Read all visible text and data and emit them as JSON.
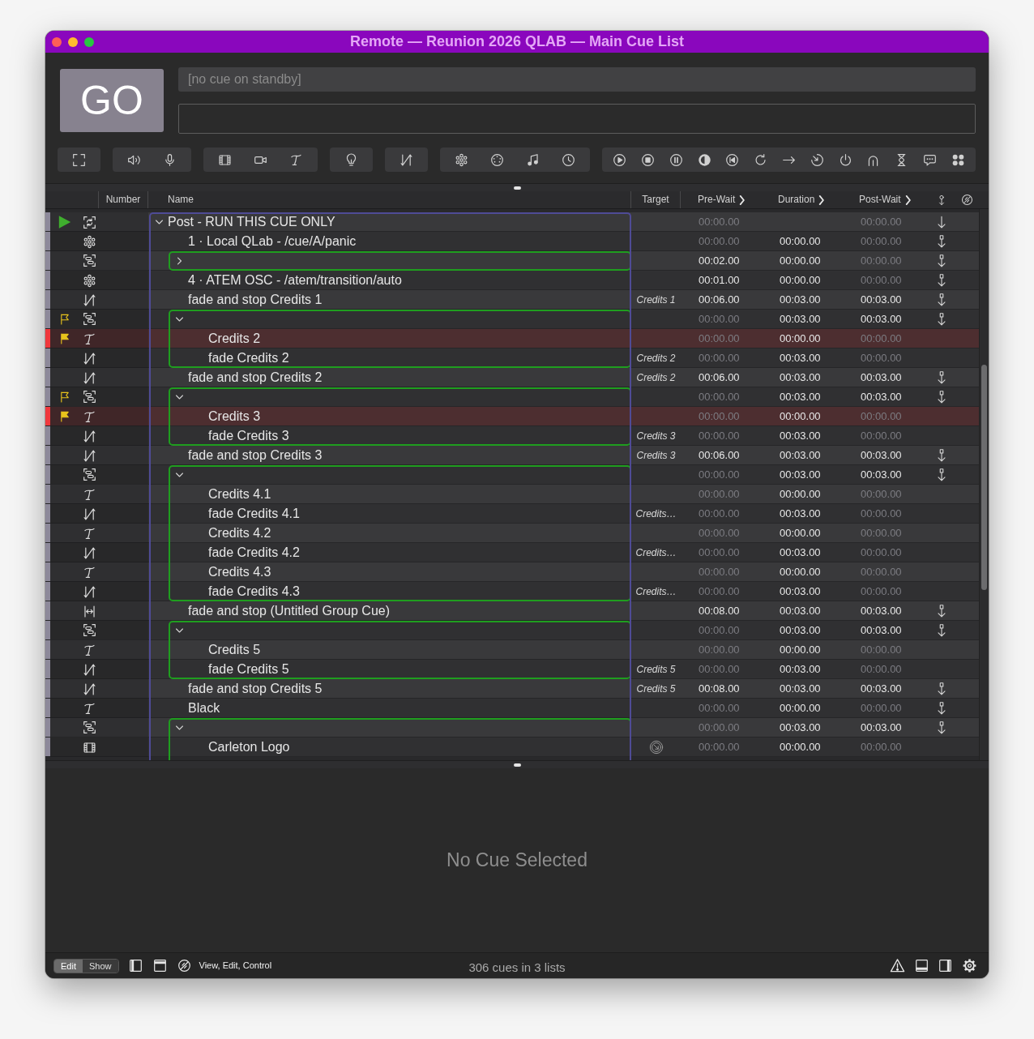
{
  "window": {
    "title": "Remote — Reunion 2026 QLAB — Main Cue List"
  },
  "go_button": {
    "label": "GO"
  },
  "standby": {
    "placeholder": "[no cue on standby]"
  },
  "toolbar": [
    {
      "buttons": [
        {
          "kind": "fullscreen"
        }
      ]
    },
    {
      "buttons": [
        {
          "kind": "audio"
        },
        {
          "kind": "mic"
        }
      ]
    },
    {
      "buttons": [
        {
          "kind": "video"
        },
        {
          "kind": "camera"
        },
        {
          "kind": "text"
        }
      ]
    },
    {
      "buttons": [
        {
          "kind": "light"
        }
      ]
    },
    {
      "buttons": [
        {
          "kind": "fade"
        }
      ]
    },
    {
      "buttons": [
        {
          "kind": "network"
        },
        {
          "kind": "midi"
        },
        {
          "kind": "music"
        },
        {
          "kind": "timecode"
        }
      ]
    },
    {
      "buttons": [
        {
          "kind": "start"
        },
        {
          "kind": "stop"
        },
        {
          "kind": "pause"
        },
        {
          "kind": "load"
        },
        {
          "kind": "goto"
        },
        {
          "kind": "reset"
        },
        {
          "kind": "target"
        },
        {
          "kind": "arm"
        },
        {
          "kind": "disarm"
        },
        {
          "kind": "devamp"
        },
        {
          "kind": "wait"
        },
        {
          "kind": "memo"
        },
        {
          "kind": "script"
        }
      ]
    }
  ],
  "cue_list": {
    "columns": [
      {
        "label": "Number",
        "chevron": false
      },
      {
        "label": "Name",
        "chevron": false
      },
      {
        "label": "Target",
        "chevron": false
      },
      {
        "label": "Pre-Wait",
        "chevron": true
      },
      {
        "label": "Duration",
        "chevron": true
      },
      {
        "label": "Post-Wait",
        "chevron": true
      }
    ],
    "cues": [
      {
        "kind": "random_group",
        "name": "Post - RUN THIS CUE ONLY",
        "expanded": true,
        "running": true,
        "flagged": false,
        "child_flagged": false,
        "pre_wait": {
          "text": "00:00.00",
          "dimmed": true
        },
        "post_wait": {
          "text": "00:00.00",
          "dimmed": true
        },
        "auto_continue": true,
        "auto_follow": false,
        "children": [
          {
            "kind": "network",
            "name": "1 · Local QLab - /cue/A/panic",
            "running": false,
            "flagged": false,
            "child_flagged": false,
            "pre_wait": {
              "text": "00:00.00",
              "dimmed": true
            },
            "duration": "00:00.00",
            "post_wait": {
              "text": "00:00.00",
              "dimmed": true
            },
            "auto_continue": false,
            "auto_follow": true
          },
          {
            "kind": "timeline_group",
            "expanded": false,
            "running": false,
            "flagged": false,
            "child_flagged": false,
            "pre_wait": {
              "text": "00:02.00",
              "dimmed": false
            },
            "duration": "00:00.00",
            "post_wait": {
              "text": "00:00.00",
              "dimmed": true
            },
            "auto_continue": false,
            "auto_follow": true
          },
          {
            "kind": "network",
            "name": "4 · ATEM OSC - /atem/transition/auto",
            "running": false,
            "flagged": false,
            "child_flagged": false,
            "pre_wait": {
              "text": "00:01.00",
              "dimmed": false
            },
            "duration": "00:00.00",
            "post_wait": {
              "text": "00:00.00",
              "dimmed": true
            },
            "auto_continue": false,
            "auto_follow": true
          },
          {
            "kind": "fade",
            "name": "fade and stop Credits 1",
            "target": "Credits 1",
            "running": false,
            "flagged": false,
            "child_flagged": false,
            "pre_wait": {
              "text": "00:06.00",
              "dimmed": false
            },
            "duration": "00:03.00",
            "post_wait": {
              "text": "00:03.00",
              "dimmed": false
            },
            "auto_continue": false,
            "auto_follow": true
          },
          {
            "kind": "timeline_group",
            "expanded": true,
            "running": false,
            "flagged": false,
            "child_flagged": true,
            "pre_wait": {
              "text": "00:00.00",
              "dimmed": true
            },
            "duration": "00:03.00",
            "post_wait": {
              "text": "00:03.00",
              "dimmed": false
            },
            "auto_continue": false,
            "auto_follow": true,
            "children": [
              {
                "kind": "text",
                "name": "Credits 2",
                "color": "#f0383d",
                "running": false,
                "flagged": true,
                "child_flagged": false,
                "pre_wait": {
                  "text": "00:00.00",
                  "dimmed": true
                },
                "duration": "00:00.00",
                "post_wait": {
                  "text": "00:00.00",
                  "dimmed": true
                },
                "auto_continue": false,
                "auto_follow": false
              },
              {
                "kind": "fade",
                "name": "fade Credits 2",
                "target": "Credits 2",
                "running": false,
                "flagged": false,
                "child_flagged": false,
                "pre_wait": {
                  "text": "00:00.00",
                  "dimmed": true
                },
                "duration": "00:03.00",
                "post_wait": {
                  "text": "00:00.00",
                  "dimmed": true
                },
                "auto_continue": false,
                "auto_follow": false
              }
            ]
          },
          {
            "kind": "fade",
            "name": "fade and stop Credits 2",
            "target": "Credits 2",
            "running": false,
            "flagged": false,
            "child_flagged": false,
            "pre_wait": {
              "text": "00:06.00",
              "dimmed": false
            },
            "duration": "00:03.00",
            "post_wait": {
              "text": "00:03.00",
              "dimmed": false
            },
            "auto_continue": false,
            "auto_follow": true
          },
          {
            "kind": "timeline_group",
            "expanded": true,
            "running": false,
            "flagged": false,
            "child_flagged": true,
            "pre_wait": {
              "text": "00:00.00",
              "dimmed": true
            },
            "duration": "00:03.00",
            "post_wait": {
              "text": "00:03.00",
              "dimmed": false
            },
            "auto_continue": false,
            "auto_follow": true,
            "children": [
              {
                "kind": "text",
                "name": "Credits 3",
                "color": "#f0383d",
                "running": false,
                "flagged": true,
                "child_flagged": false,
                "pre_wait": {
                  "text": "00:00.00",
                  "dimmed": true
                },
                "duration": "00:00.00",
                "post_wait": {
                  "text": "00:00.00",
                  "dimmed": true
                },
                "auto_continue": false,
                "auto_follow": false
              },
              {
                "kind": "fade",
                "name": "fade Credits 3",
                "target": "Credits 3",
                "running": false,
                "flagged": false,
                "child_flagged": false,
                "pre_wait": {
                  "text": "00:00.00",
                  "dimmed": true
                },
                "duration": "00:03.00",
                "post_wait": {
                  "text": "00:00.00",
                  "dimmed": true
                },
                "auto_continue": false,
                "auto_follow": false
              }
            ]
          },
          {
            "kind": "fade",
            "name": "fade and stop Credits 3",
            "target": "Credits 3",
            "running": false,
            "flagged": false,
            "child_flagged": false,
            "pre_wait": {
              "text": "00:06.00",
              "dimmed": false
            },
            "duration": "00:03.00",
            "post_wait": {
              "text": "00:03.00",
              "dimmed": false
            },
            "auto_continue": false,
            "auto_follow": true
          },
          {
            "kind": "timeline_group",
            "expanded": true,
            "running": false,
            "flagged": false,
            "child_flagged": false,
            "pre_wait": {
              "text": "00:00.00",
              "dimmed": true
            },
            "duration": "00:03.00",
            "post_wait": {
              "text": "00:03.00",
              "dimmed": false
            },
            "auto_continue": false,
            "auto_follow": true,
            "children": [
              {
                "kind": "text",
                "name": "Credits 4.1",
                "running": false,
                "flagged": false,
                "child_flagged": false,
                "pre_wait": {
                  "text": "00:00.00",
                  "dimmed": true
                },
                "duration": "00:00.00",
                "post_wait": {
                  "text": "00:00.00",
                  "dimmed": true
                },
                "auto_continue": false,
                "auto_follow": false
              },
              {
                "kind": "fade",
                "name": "fade Credits 4.1",
                "target": "Credits…",
                "running": false,
                "flagged": false,
                "child_flagged": false,
                "pre_wait": {
                  "text": "00:00.00",
                  "dimmed": true
                },
                "duration": "00:03.00",
                "post_wait": {
                  "text": "00:00.00",
                  "dimmed": true
                },
                "auto_continue": false,
                "auto_follow": false
              },
              {
                "kind": "text",
                "name": "Credits 4.2",
                "running": false,
                "flagged": false,
                "child_flagged": false,
                "pre_wait": {
                  "text": "00:00.00",
                  "dimmed": true
                },
                "duration": "00:00.00",
                "post_wait": {
                  "text": "00:00.00",
                  "dimmed": true
                },
                "auto_continue": false,
                "auto_follow": false
              },
              {
                "kind": "fade",
                "name": "fade Credits 4.2",
                "target": "Credits…",
                "running": false,
                "flagged": false,
                "child_flagged": false,
                "pre_wait": {
                  "text": "00:00.00",
                  "dimmed": true
                },
                "duration": "00:03.00",
                "post_wait": {
                  "text": "00:00.00",
                  "dimmed": true
                },
                "auto_continue": false,
                "auto_follow": false
              },
              {
                "kind": "text",
                "name": "Credits 4.3",
                "running": false,
                "flagged": false,
                "child_flagged": false,
                "pre_wait": {
                  "text": "00:00.00",
                  "dimmed": true
                },
                "duration": "00:00.00",
                "post_wait": {
                  "text": "00:00.00",
                  "dimmed": true
                },
                "auto_continue": false,
                "auto_follow": false
              },
              {
                "kind": "fade",
                "name": "fade Credits 4.3",
                "target": "Credits…",
                "running": false,
                "flagged": false,
                "child_flagged": false,
                "pre_wait": {
                  "text": "00:00.00",
                  "dimmed": true
                },
                "duration": "00:03.00",
                "post_wait": {
                  "text": "00:00.00",
                  "dimmed": true
                },
                "auto_continue": false,
                "auto_follow": false
              }
            ]
          },
          {
            "kind": "group_fade",
            "name": "fade and stop (Untitled Group Cue)",
            "running": false,
            "flagged": false,
            "child_flagged": false,
            "pre_wait": {
              "text": "00:08.00",
              "dimmed": false
            },
            "duration": "00:03.00",
            "post_wait": {
              "text": "00:03.00",
              "dimmed": false
            },
            "auto_continue": false,
            "auto_follow": true
          },
          {
            "kind": "timeline_group",
            "expanded": true,
            "running": false,
            "flagged": false,
            "child_flagged": false,
            "pre_wait": {
              "text": "00:00.00",
              "dimmed": true
            },
            "duration": "00:03.00",
            "post_wait": {
              "text": "00:03.00",
              "dimmed": false
            },
            "auto_continue": false,
            "auto_follow": true,
            "children": [
              {
                "kind": "text",
                "name": "Credits 5",
                "running": false,
                "flagged": false,
                "child_flagged": false,
                "pre_wait": {
                  "text": "00:00.00",
                  "dimmed": true
                },
                "duration": "00:00.00",
                "post_wait": {
                  "text": "00:00.00",
                  "dimmed": true
                },
                "auto_continue": false,
                "auto_follow": false
              },
              {
                "kind": "fade",
                "name": "fade Credits 5",
                "target": "Credits 5",
                "running": false,
                "flagged": false,
                "child_flagged": false,
                "pre_wait": {
                  "text": "00:00.00",
                  "dimmed": true
                },
                "duration": "00:03.00",
                "post_wait": {
                  "text": "00:00.00",
                  "dimmed": true
                },
                "auto_continue": false,
                "auto_follow": false
              }
            ]
          },
          {
            "kind": "fade",
            "name": "fade and stop Credits 5",
            "target": "Credits 5",
            "running": false,
            "flagged": false,
            "child_flagged": false,
            "pre_wait": {
              "text": "00:08.00",
              "dimmed": false
            },
            "duration": "00:03.00",
            "post_wait": {
              "text": "00:03.00",
              "dimmed": false
            },
            "auto_continue": false,
            "auto_follow": true
          },
          {
            "kind": "text",
            "name": "Black",
            "running": false,
            "flagged": false,
            "child_flagged": false,
            "pre_wait": {
              "text": "00:00.00",
              "dimmed": true
            },
            "duration": "00:00.00",
            "post_wait": {
              "text": "00:00.00",
              "dimmed": true
            },
            "auto_continue": false,
            "auto_follow": true
          },
          {
            "kind": "timeline_group",
            "expanded": true,
            "running": false,
            "flagged": false,
            "child_flagged": false,
            "pre_wait": {
              "text": "00:00.00",
              "dimmed": true
            },
            "duration": "00:03.00",
            "post_wait": {
              "text": "00:03.00",
              "dimmed": false
            },
            "auto_continue": false,
            "auto_follow": true,
            "children": [
              {
                "kind": "video",
                "name": "Carleton Logo",
                "target_icon": true,
                "running": false,
                "flagged": false,
                "child_flagged": false,
                "pre_wait": {
                  "text": "00:00.00",
                  "dimmed": true
                },
                "duration": "00:00.00",
                "post_wait": {
                  "text": "00:00.00",
                  "dimmed": true
                },
                "auto_continue": false,
                "auto_follow": false
              }
            ]
          }
        ]
      }
    ]
  },
  "inspector": {
    "message": "No Cue Selected"
  },
  "status_bar": {
    "modes": [
      {
        "label": "Edit",
        "selected": true
      },
      {
        "label": "Show",
        "selected": false
      }
    ],
    "access": "View, Edit, Control",
    "summary": "306 cues in 3 lists"
  }
}
